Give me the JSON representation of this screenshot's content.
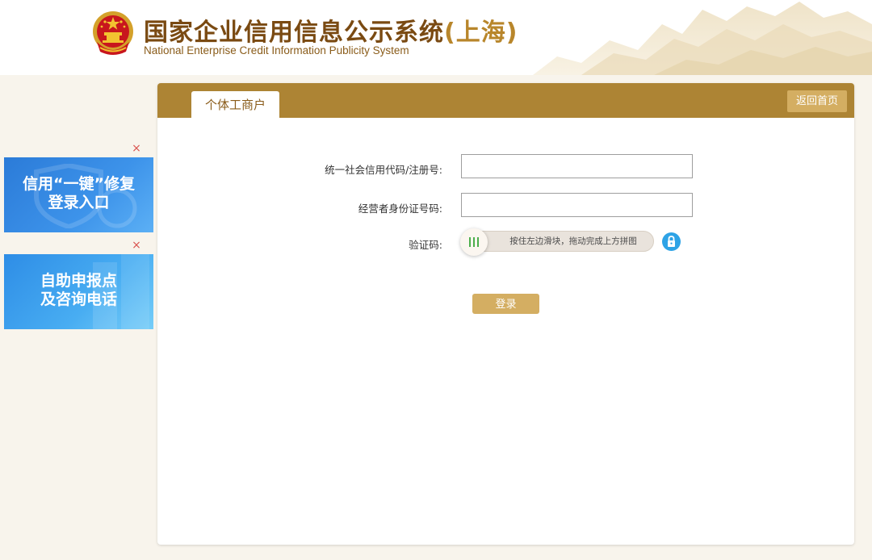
{
  "header": {
    "title_cn": "国家企业信用信息公示系统",
    "title_region": "(上海)",
    "title_en": "National Enterprise Credit Information Publicity System"
  },
  "ads": [
    {
      "close_label": "×",
      "line1": "信用“一键”修复",
      "line2": "登录入口"
    },
    {
      "close_label": "×",
      "line1": "自助申报点",
      "line2": "及咨询电话"
    }
  ],
  "panel": {
    "tab_label": "个体工商户",
    "back_label": "返回首页"
  },
  "form": {
    "code_label": "统一社会信用代码/注册号:",
    "code_value": "",
    "id_label": "经营者身份证号码:",
    "id_value": "",
    "captcha_label": "验证码:",
    "slider_hint": "按住左边滑块，拖动完成上方拼图",
    "login_label": "登录"
  },
  "colors": {
    "brand_gold": "#ad8434",
    "button_gold": "#d4ae62",
    "title_brown": "#7a4a12",
    "ad_blue": "#2b7bd8",
    "lock_blue": "#2ea3e6",
    "close_red": "#d9534f"
  },
  "icons": {
    "emblem": "national-emblem-icon",
    "close": "close-icon",
    "slider": "slider-handle-icon",
    "lock": "lock-icon"
  }
}
